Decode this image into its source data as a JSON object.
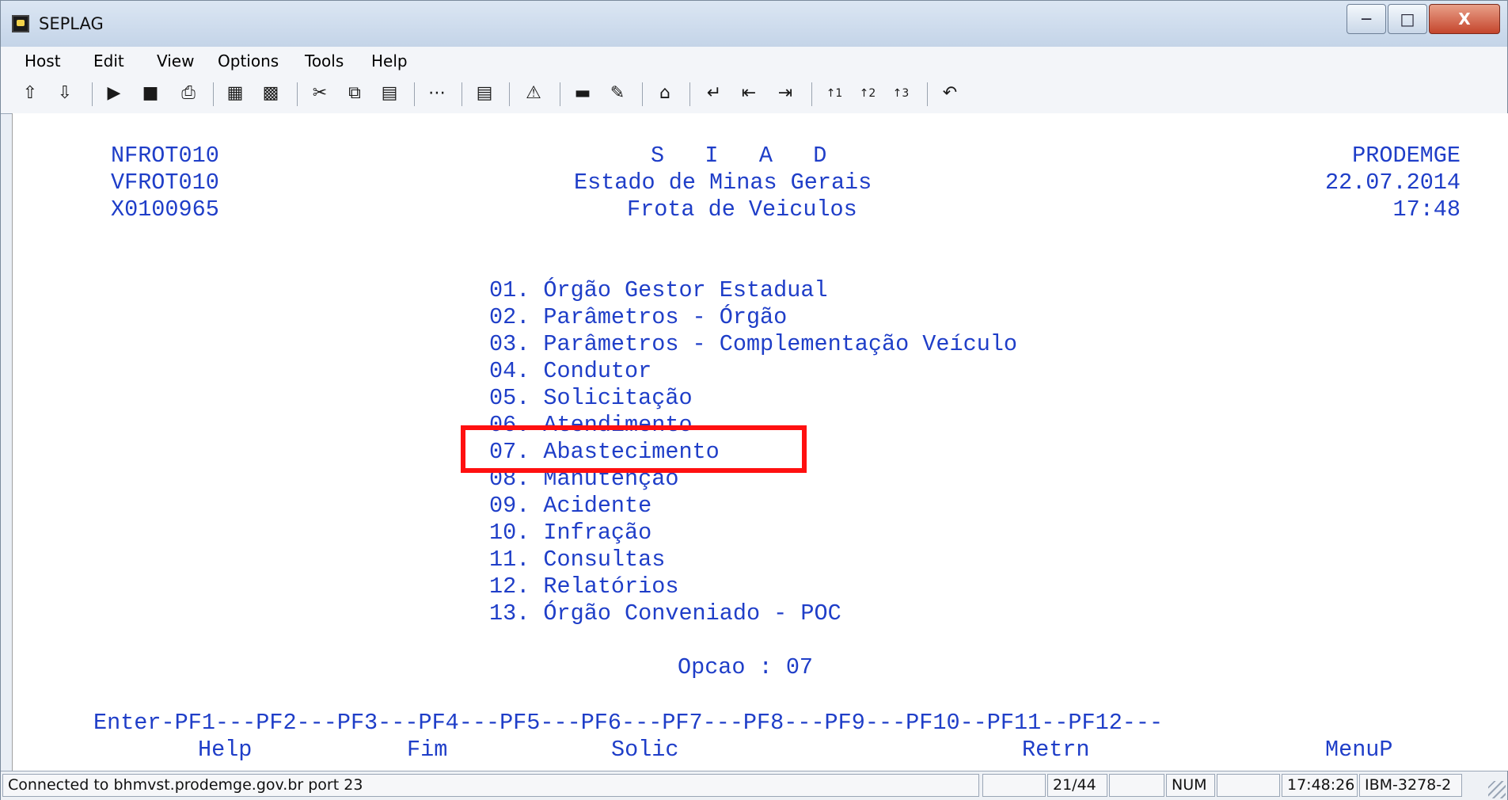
{
  "window": {
    "title": "SEPLAG"
  },
  "menu": [
    "Host",
    "Edit",
    "View",
    "Options",
    "Tools",
    "Help"
  ],
  "toolbar_icons": [
    "send-file-icon",
    "receive-file-icon",
    "macro-run-icon",
    "macro-record-icon",
    "print-icon",
    "screen-save-icon",
    "screen-load-icon",
    "cut-icon",
    "copy-icon",
    "paste-icon",
    "dots-icon",
    "chart-icon",
    "warning-icon",
    "display-icon",
    "pen-icon",
    "home-icon",
    "enter-icon",
    "field-back-icon",
    "tab-icon",
    "pf1-icon",
    "pf2-icon",
    "pf3-icon",
    "undo-icon"
  ],
  "screen": {
    "header_left": [
      "NFROT010",
      "VFROT010",
      "X0100965"
    ],
    "header_center": [
      "S   I   A   D",
      "Estado de Minas Gerais",
      "Frota de Veiculos"
    ],
    "header_right": [
      "PRODEMGE",
      "22.07.2014",
      "17:48"
    ],
    "menu_options": [
      "01. Órgão Gestor Estadual",
      "02. Parâmetros - Órgão",
      "03. Parâmetros - Complementação Veículo",
      "04. Condutor",
      "05. Solicitação",
      "06. Atendimento",
      "07. Abastecimento",
      "08. Manutenção",
      "09. Acidente",
      "10. Infração",
      "11. Consultas",
      "12. Relatórios",
      "13. Órgão Conveniado - POC"
    ],
    "highlighted_option": "07. Abastecimento",
    "prompt": "Opcao : 07",
    "pf_keys": "Enter-PF1---PF2---PF3---PF4---PF5---PF6---PF7---PF8---PF9---PF10--PF11--PF12---",
    "pf_labels": {
      "help": "Help",
      "fim": "Fim",
      "solic": "Solic",
      "retrn": "Retrn",
      "menup": "MenuP"
    }
  },
  "statusbar": {
    "connection": "Connected to bhmvst.prodemge.gov.br port 23",
    "cursor": "21/44",
    "num": "NUM",
    "clock": "17:48:26",
    "terminal": "IBM-3278-2"
  },
  "colors": {
    "terminal_text": "#1f3ec8",
    "highlight_box": "#ff1010"
  }
}
